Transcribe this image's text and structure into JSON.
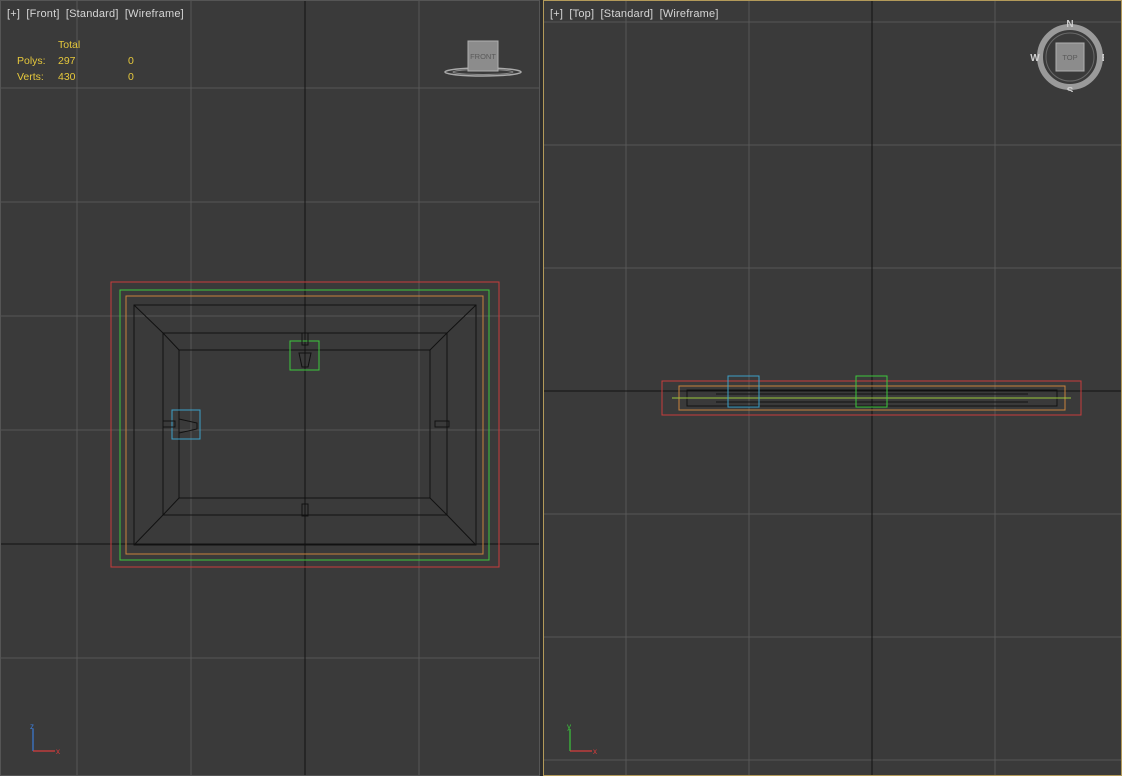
{
  "front": {
    "labels": [
      "[+]",
      "[Front]",
      "[Standard]",
      "[Wireframe]"
    ],
    "stats": {
      "header": "Total",
      "rows": [
        {
          "label": "Polys:",
          "total": "297",
          "selected": "0"
        },
        {
          "label": "Verts:",
          "total": "430",
          "selected": "0"
        }
      ]
    },
    "viewcube_label": "FRONT",
    "axis_labels": {
      "up": "z",
      "right": "x"
    }
  },
  "top": {
    "labels": [
      "[+]",
      "[Top]",
      "[Standard]",
      "[Wireframe]"
    ],
    "viewcube_label": "TOP",
    "compass": {
      "n": "N",
      "s": "S",
      "e": "E",
      "w": "W"
    },
    "axis_labels": {
      "up": "y",
      "right": "x"
    }
  },
  "colors": {
    "viewport_bg": "#3a3a3a",
    "grid": "#5a5a5a",
    "axis": "#111111",
    "stats": "#e6c83c",
    "red": "#c83c3c",
    "green": "#3cc83c",
    "orange": "#c8823c",
    "cyan": "#3ca0c8",
    "active_border": "#b39a5a"
  }
}
